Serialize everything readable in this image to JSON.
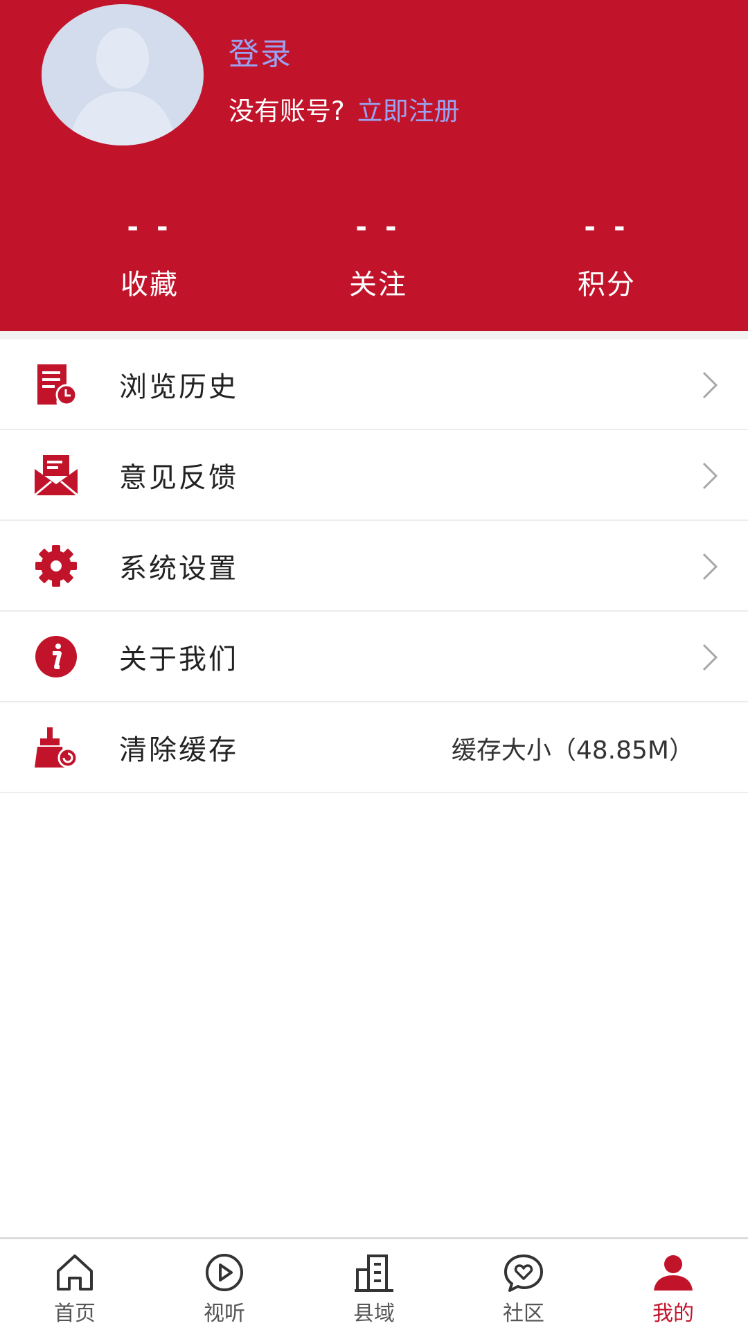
{
  "header": {
    "login_label": "登录",
    "no_account_text": "没有账号?",
    "register_link": "立即注册",
    "stats": [
      {
        "value": "- -",
        "label": "收藏"
      },
      {
        "value": "- -",
        "label": "关注"
      },
      {
        "value": "- -",
        "label": "积分"
      }
    ]
  },
  "menu": {
    "items": [
      {
        "label": "浏览历史",
        "icon": "history-icon"
      },
      {
        "label": "意见反馈",
        "icon": "feedback-mail-icon"
      },
      {
        "label": "系统设置",
        "icon": "gear-icon"
      },
      {
        "label": "关于我们",
        "icon": "info-icon"
      },
      {
        "label": "清除缓存",
        "icon": "broom-icon",
        "value": "缓存大小（48.85M）"
      }
    ]
  },
  "bottom_nav": {
    "items": [
      {
        "label": "首页",
        "icon": "home-icon"
      },
      {
        "label": "视听",
        "icon": "play-icon"
      },
      {
        "label": "县域",
        "icon": "building-icon"
      },
      {
        "label": "社区",
        "icon": "chat-heart-icon"
      },
      {
        "label": "我的",
        "icon": "user-icon",
        "active": true
      }
    ]
  },
  "colors": {
    "brand_red": "#c1142b",
    "link_blue": "#9aa3f2",
    "avatar_bg": "#d3dcec"
  }
}
